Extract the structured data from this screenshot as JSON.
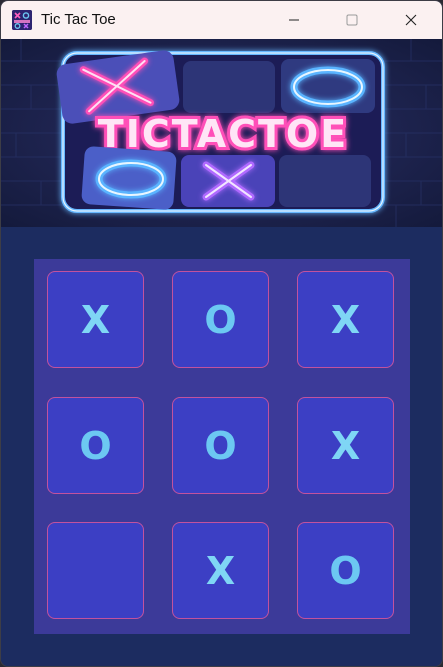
{
  "window": {
    "title": "Tic Tac Toe",
    "icon": "tictactoe-app-icon"
  },
  "controls": {
    "minimize_icon": "minimize-icon",
    "maximize_icon": "maximize-icon",
    "close_icon": "close-icon"
  },
  "banner": {
    "logo_text": "TICTACTOE",
    "tiles_top": [
      "X",
      "",
      "O"
    ],
    "tiles_bottom": [
      "O",
      "X",
      ""
    ]
  },
  "board": {
    "cells": [
      [
        "X",
        "O",
        "X"
      ],
      [
        "O",
        "O",
        "X"
      ],
      [
        "",
        "X",
        "O"
      ]
    ]
  },
  "colors": {
    "window_background": "#1c2b5e",
    "board_background": "#3c3a99",
    "cell_background": "#3c3fc4",
    "cell_border": "#c2529e",
    "mark_x": "#7fd6f5",
    "mark_o": "#6cc8f2",
    "neon_pink": "#ff4fb8",
    "neon_blue": "#5ab4ff"
  }
}
